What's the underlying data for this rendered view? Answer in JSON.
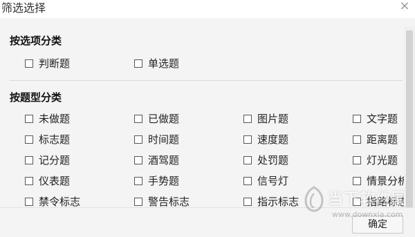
{
  "window": {
    "title": "筛选选择",
    "close_label": "×"
  },
  "by_option": {
    "heading": "按选项分类",
    "items": [
      "判断题",
      "单选题"
    ]
  },
  "by_type": {
    "heading": "按题型分类",
    "items": [
      "未做题",
      "已做题",
      "图片题",
      "文字题",
      "标志题",
      "时间题",
      "速度题",
      "距离题",
      "记分题",
      "酒驾题",
      "处罚题",
      "灯光题",
      "仪表题",
      "手势题",
      "信号灯",
      "情景分析",
      "禁令标志",
      "警告标志",
      "指示标志",
      "指路标志"
    ]
  },
  "footer": {
    "ok_label": "确定"
  },
  "watermark": {
    "brand": "当下软件园",
    "url": "www.downxia.com"
  }
}
